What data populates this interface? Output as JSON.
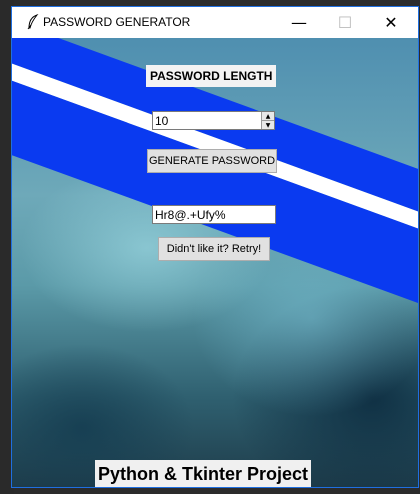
{
  "window": {
    "title": "PASSWORD GENERATOR",
    "minimize_glyph": "—",
    "maximize_glyph": "☐",
    "close_glyph": "✕"
  },
  "form": {
    "length_label": "PASSWORD LENGTH",
    "length_value": "10",
    "generate_label": "GENERATE PASSWORD",
    "password_value": "Hr8@.+Ufy%",
    "retry_label": "Didn't like it? Retry!"
  },
  "footer": {
    "caption": "Python & Tkinter Project"
  },
  "colors": {
    "band_blue": "#0a3af0",
    "window_border": "#1f6fe0"
  },
  "icons": {
    "app": "feather-icon",
    "spin_up": "triangle-up-icon",
    "spin_down": "triangle-down-icon"
  }
}
